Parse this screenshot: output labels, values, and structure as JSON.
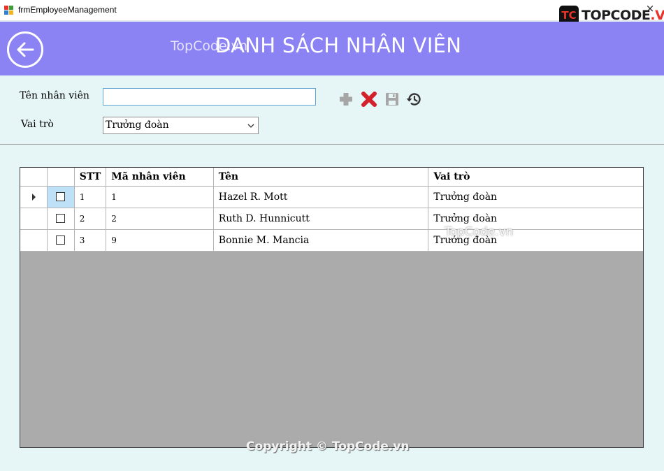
{
  "window": {
    "title": "frmEmployeeManagement",
    "close_glyph": "×"
  },
  "watermark": {
    "logo_mark": "TC",
    "logo_text_1": "TOPCODE",
    "logo_text_2": ".VN",
    "header": "TopCode.vn",
    "middle": "TopCode.vn",
    "bottom": "Copyright © TopCode.vn"
  },
  "header": {
    "title": "DANH SÁCH NHÂN VIÊN",
    "back_icon": "arrow-left-circle-icon",
    "background": "#8b82f4"
  },
  "form": {
    "name_label": "Tên nhân viên",
    "name_value": "",
    "role_label": "Vai trò",
    "role_value": "Trưởng đoàn"
  },
  "toolbar": {
    "icons": [
      "plus-icon",
      "delete-x-icon",
      "save-floppy-icon",
      "history-icon"
    ]
  },
  "grid": {
    "columns": [
      "",
      "",
      "STT",
      "Mã nhân viên",
      "Tên",
      "Vai trò"
    ],
    "rows": [
      {
        "stt": "1",
        "code": "1",
        "name": "Hazel R. Mott",
        "role": "Trưởng đoàn",
        "checked": false,
        "current": true
      },
      {
        "stt": "2",
        "code": "2",
        "name": "Ruth D. Hunnicutt",
        "role": "Trưởng đoàn",
        "checked": false,
        "current": false
      },
      {
        "stt": "3",
        "code": "9",
        "name": "Bonnie M. Mancia",
        "role": "Trưởng đoàn",
        "checked": false,
        "current": false
      }
    ]
  }
}
